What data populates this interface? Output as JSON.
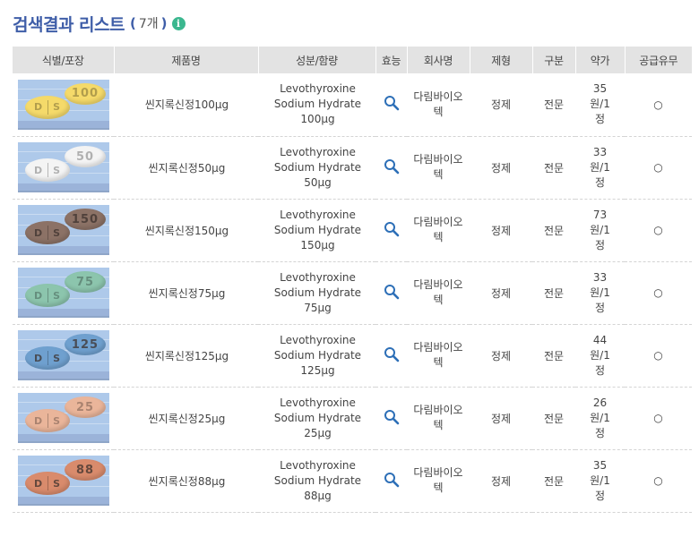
{
  "page": {
    "title": "검색결과 리스트",
    "count_open": "(",
    "count": "7개",
    "count_close": ")",
    "info_icon_glyph": "i"
  },
  "table": {
    "headers": [
      "식별/포장",
      "제품명",
      "성분/함량",
      "효능",
      "회사명",
      "제형",
      "구분",
      "약가",
      "공급유무"
    ],
    "rows": [
      {
        "pill_color": "#f5da6a",
        "pill_text": "100",
        "front_text": [
          "D",
          "S"
        ],
        "name": "씬지록신정100μg",
        "ingredient": [
          "Levothyroxine",
          "Sodium Hydrate",
          "100μg"
        ],
        "efficacy_icon": "search-icon",
        "company": "다림바이오텍",
        "form": "정제",
        "category": "전문",
        "price": "35원/1정",
        "supply": "○"
      },
      {
        "pill_color": "#f4f4f4",
        "pill_text": "50",
        "front_text": [
          "D",
          "S"
        ],
        "name": "씬지록신정50μg",
        "ingredient": [
          "Levothyroxine",
          "Sodium Hydrate",
          "50μg"
        ],
        "efficacy_icon": "search-icon",
        "company": "다림바이오텍",
        "form": "정제",
        "category": "전문",
        "price": "33원/1정",
        "supply": "○"
      },
      {
        "pill_color": "#8c7266",
        "pill_text": "150",
        "front_text": [
          "D",
          "S"
        ],
        "name": "씬지록신정150μg",
        "ingredient": [
          "Levothyroxine",
          "Sodium Hydrate",
          "150μg"
        ],
        "efficacy_icon": "search-icon",
        "company": "다림바이오텍",
        "form": "정제",
        "category": "전문",
        "price": "73원/1정",
        "supply": "○"
      },
      {
        "pill_color": "#8cc5ad",
        "pill_text": "75",
        "front_text": [
          "D",
          "S"
        ],
        "name": "씬지록신정75μg",
        "ingredient": [
          "Levothyroxine",
          "Sodium Hydrate",
          "75μg"
        ],
        "efficacy_icon": "search-icon",
        "company": "다림바이오텍",
        "form": "정제",
        "category": "전문",
        "price": "33원/1정",
        "supply": "○"
      },
      {
        "pill_color": "#6fa0cf",
        "pill_text": "125",
        "front_text": [
          "D",
          "S"
        ],
        "name": "씬지록신정125μg",
        "ingredient": [
          "Levothyroxine",
          "Sodium Hydrate",
          "125μg"
        ],
        "efficacy_icon": "search-icon",
        "company": "다림바이오텍",
        "form": "정제",
        "category": "전문",
        "price": "44원/1정",
        "supply": "○"
      },
      {
        "pill_color": "#eab59a",
        "pill_text": "25",
        "front_text": [
          "D",
          "S"
        ],
        "name": "씬지록신정25μg",
        "ingredient": [
          "Levothyroxine",
          "Sodium Hydrate",
          "25μg"
        ],
        "efficacy_icon": "search-icon",
        "company": "다림바이오텍",
        "form": "정제",
        "category": "전문",
        "price": "26원/1정",
        "supply": "○"
      },
      {
        "pill_color": "#d98b6c",
        "pill_text": "88",
        "front_text": [
          "D",
          "S"
        ],
        "name": "씬지록신정88μg",
        "ingredient": [
          "Levothyroxine",
          "Sodium Hydrate",
          "88μg"
        ],
        "efficacy_icon": "search-icon",
        "company": "다림바이오텍",
        "form": "정제",
        "category": "전문",
        "price": "35원/1정",
        "supply": "○"
      }
    ]
  }
}
